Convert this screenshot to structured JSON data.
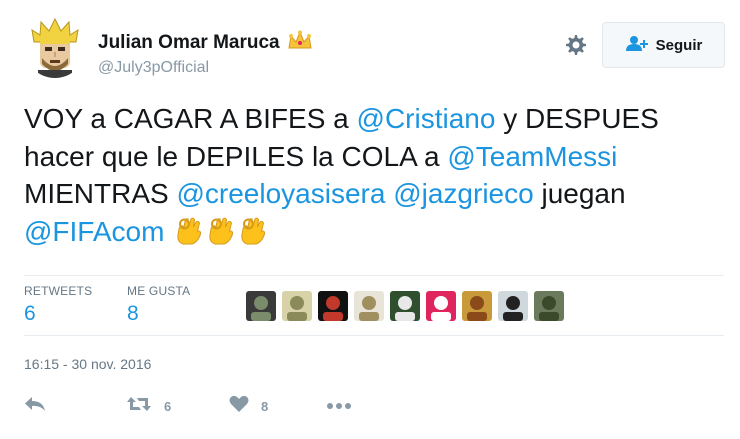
{
  "user": {
    "display_name": "Julian Omar Maruca",
    "handle": "@July3pOfficial"
  },
  "follow_button": {
    "label": "Seguir"
  },
  "tweet": {
    "segments": [
      {
        "text": "VOY a CAGAR A BIFES a ",
        "mention": false
      },
      {
        "text": "@Cristiano",
        "mention": true
      },
      {
        "text": " y DESPUES hacer que le DEPILES la COLA a ",
        "mention": false
      },
      {
        "text": "@TeamMessi",
        "mention": true
      },
      {
        "text": " MIENTRAS ",
        "mention": false
      },
      {
        "text": "@creeloyasisera",
        "mention": true
      },
      {
        "text": " ",
        "mention": false
      },
      {
        "text": "@jazgrieco",
        "mention": true
      },
      {
        "text": " juegan ",
        "mention": false
      },
      {
        "text": "@FIFAcom",
        "mention": true
      },
      {
        "text": " ",
        "mention": false
      }
    ],
    "emoji_count": 3
  },
  "stats": {
    "retweets_label": "RETWEETS",
    "retweets_value": "6",
    "likes_label": "ME GUSTA",
    "likes_value": "8"
  },
  "likers": [
    {
      "name": "liker-1",
      "bg": "#3a3a3a",
      "fg": "#7a8c6a"
    },
    {
      "name": "liker-2",
      "bg": "#d8d2a8",
      "fg": "#8a8a5a"
    },
    {
      "name": "liker-3",
      "bg": "#111111",
      "fg": "#c0392b"
    },
    {
      "name": "liker-4",
      "bg": "#e8e4d8",
      "fg": "#a09060"
    },
    {
      "name": "liker-5",
      "bg": "#2f4f2f",
      "fg": "#e8e8e8"
    },
    {
      "name": "liker-6",
      "bg": "#e0245e",
      "fg": "#ffffff"
    },
    {
      "name": "liker-7",
      "bg": "#c89a3a",
      "fg": "#8a4a1a"
    },
    {
      "name": "liker-8",
      "bg": "#cfd8dc",
      "fg": "#222222"
    },
    {
      "name": "liker-9",
      "bg": "#6b7a5a",
      "fg": "#3a4a2a"
    }
  ],
  "timestamp": "16:15 - 30 nov. 2016",
  "actions": {
    "retweet_count": "6",
    "like_count": "8"
  },
  "colors": {
    "mention": "#1b95e0",
    "text": "#14171a",
    "muted": "#657786",
    "icon": "#8899a6"
  }
}
